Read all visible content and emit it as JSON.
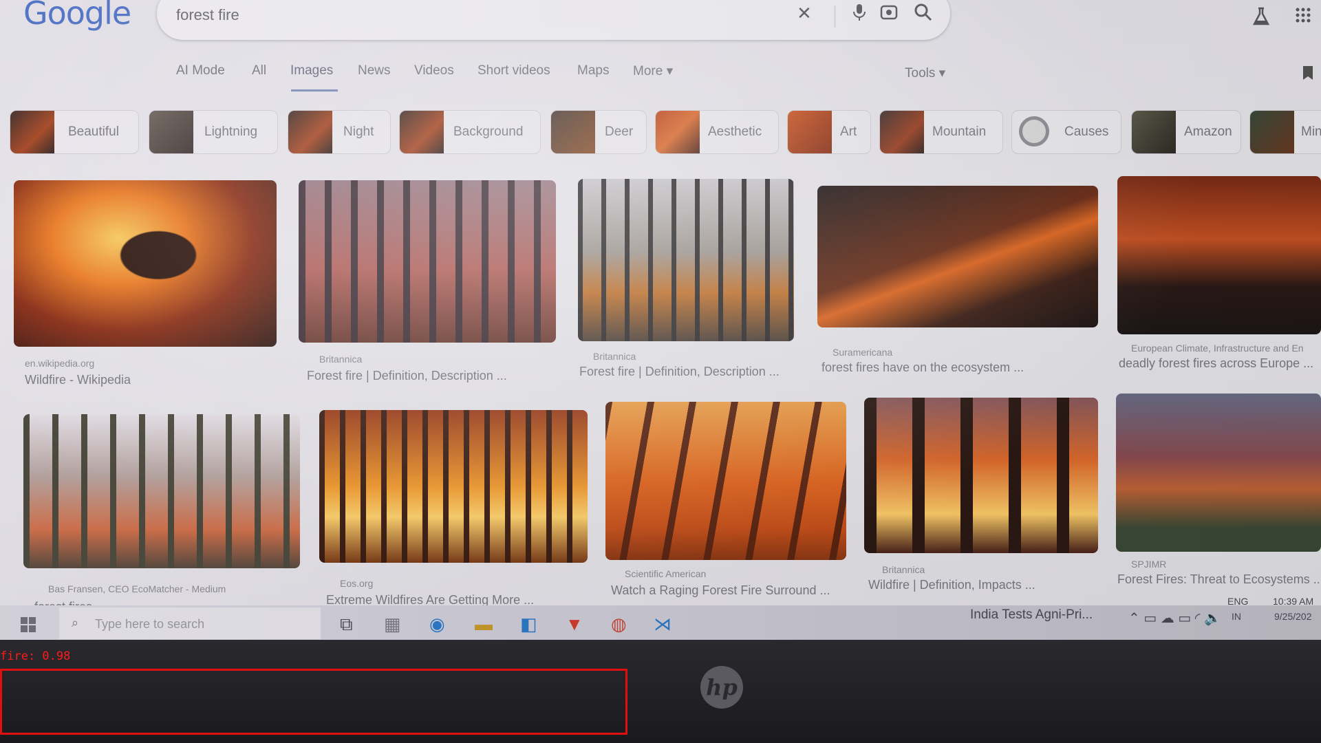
{
  "google": {
    "logo_text": "Google",
    "search_value": "forest fire"
  },
  "tabs": [
    {
      "label": "AI Mode"
    },
    {
      "label": "All"
    },
    {
      "label": "Images",
      "active": true
    },
    {
      "label": "News"
    },
    {
      "label": "Videos"
    },
    {
      "label": "Short videos"
    },
    {
      "label": "Maps"
    },
    {
      "label": "More ▾"
    }
  ],
  "tools_label": "Tools ▾",
  "chips": [
    {
      "label": "Beautiful"
    },
    {
      "label": "Lightning"
    },
    {
      "label": "Night"
    },
    {
      "label": "Background"
    },
    {
      "label": "Deer"
    },
    {
      "label": "Aesthetic"
    },
    {
      "label": "Art"
    },
    {
      "label": "Mountain"
    },
    {
      "label": "Causes"
    },
    {
      "label": "Amazon"
    },
    {
      "label": "Mine"
    }
  ],
  "results": [
    {
      "source": "en.wikipedia.org",
      "title": "Wildfire - Wikipedia"
    },
    {
      "source": "Britannica",
      "title": "Forest fire | Definition, Description ..."
    },
    {
      "source": "Britannica",
      "title": "Forest fire | Definition, Description ..."
    },
    {
      "source": "Suramericana",
      "title": "forest fires have on the ecosystem ..."
    },
    {
      "source": "European Climate, Infrastructure and En",
      "title": "deadly forest fires across Europe ..."
    },
    {
      "source": "Bas Fransen, CEO EcoMatcher - Medium",
      "title": "forest fires ..."
    },
    {
      "source": "Eos.org",
      "title": "Extreme Wildfires Are Getting More ..."
    },
    {
      "source": "Scientific American",
      "title": "Watch a Raging Forest Fire Surround ..."
    },
    {
      "source": "Britannica",
      "title": "Wildfire | Definition, Impacts ..."
    },
    {
      "source": "SPJIMR",
      "title": "Forest Fires: Threat to Ecosystems ..."
    }
  ],
  "taskbar": {
    "search_placeholder": "Type here to search",
    "news_text": "India Tests Agni-Pri...",
    "lang_top": "ENG",
    "lang_bottom": "IN",
    "time": "10:39 AM",
    "date": "9/25/202"
  },
  "laptop": {
    "brand": "hp"
  },
  "detection": {
    "label": "fire: 0.98",
    "color": "#e01010"
  },
  "icons": {
    "clear": "close-icon",
    "voice": "microphone-icon",
    "lens": "camera-lens-icon",
    "search": "search-icon",
    "labs": "flask-icon",
    "apps": "grid-apps-icon"
  }
}
